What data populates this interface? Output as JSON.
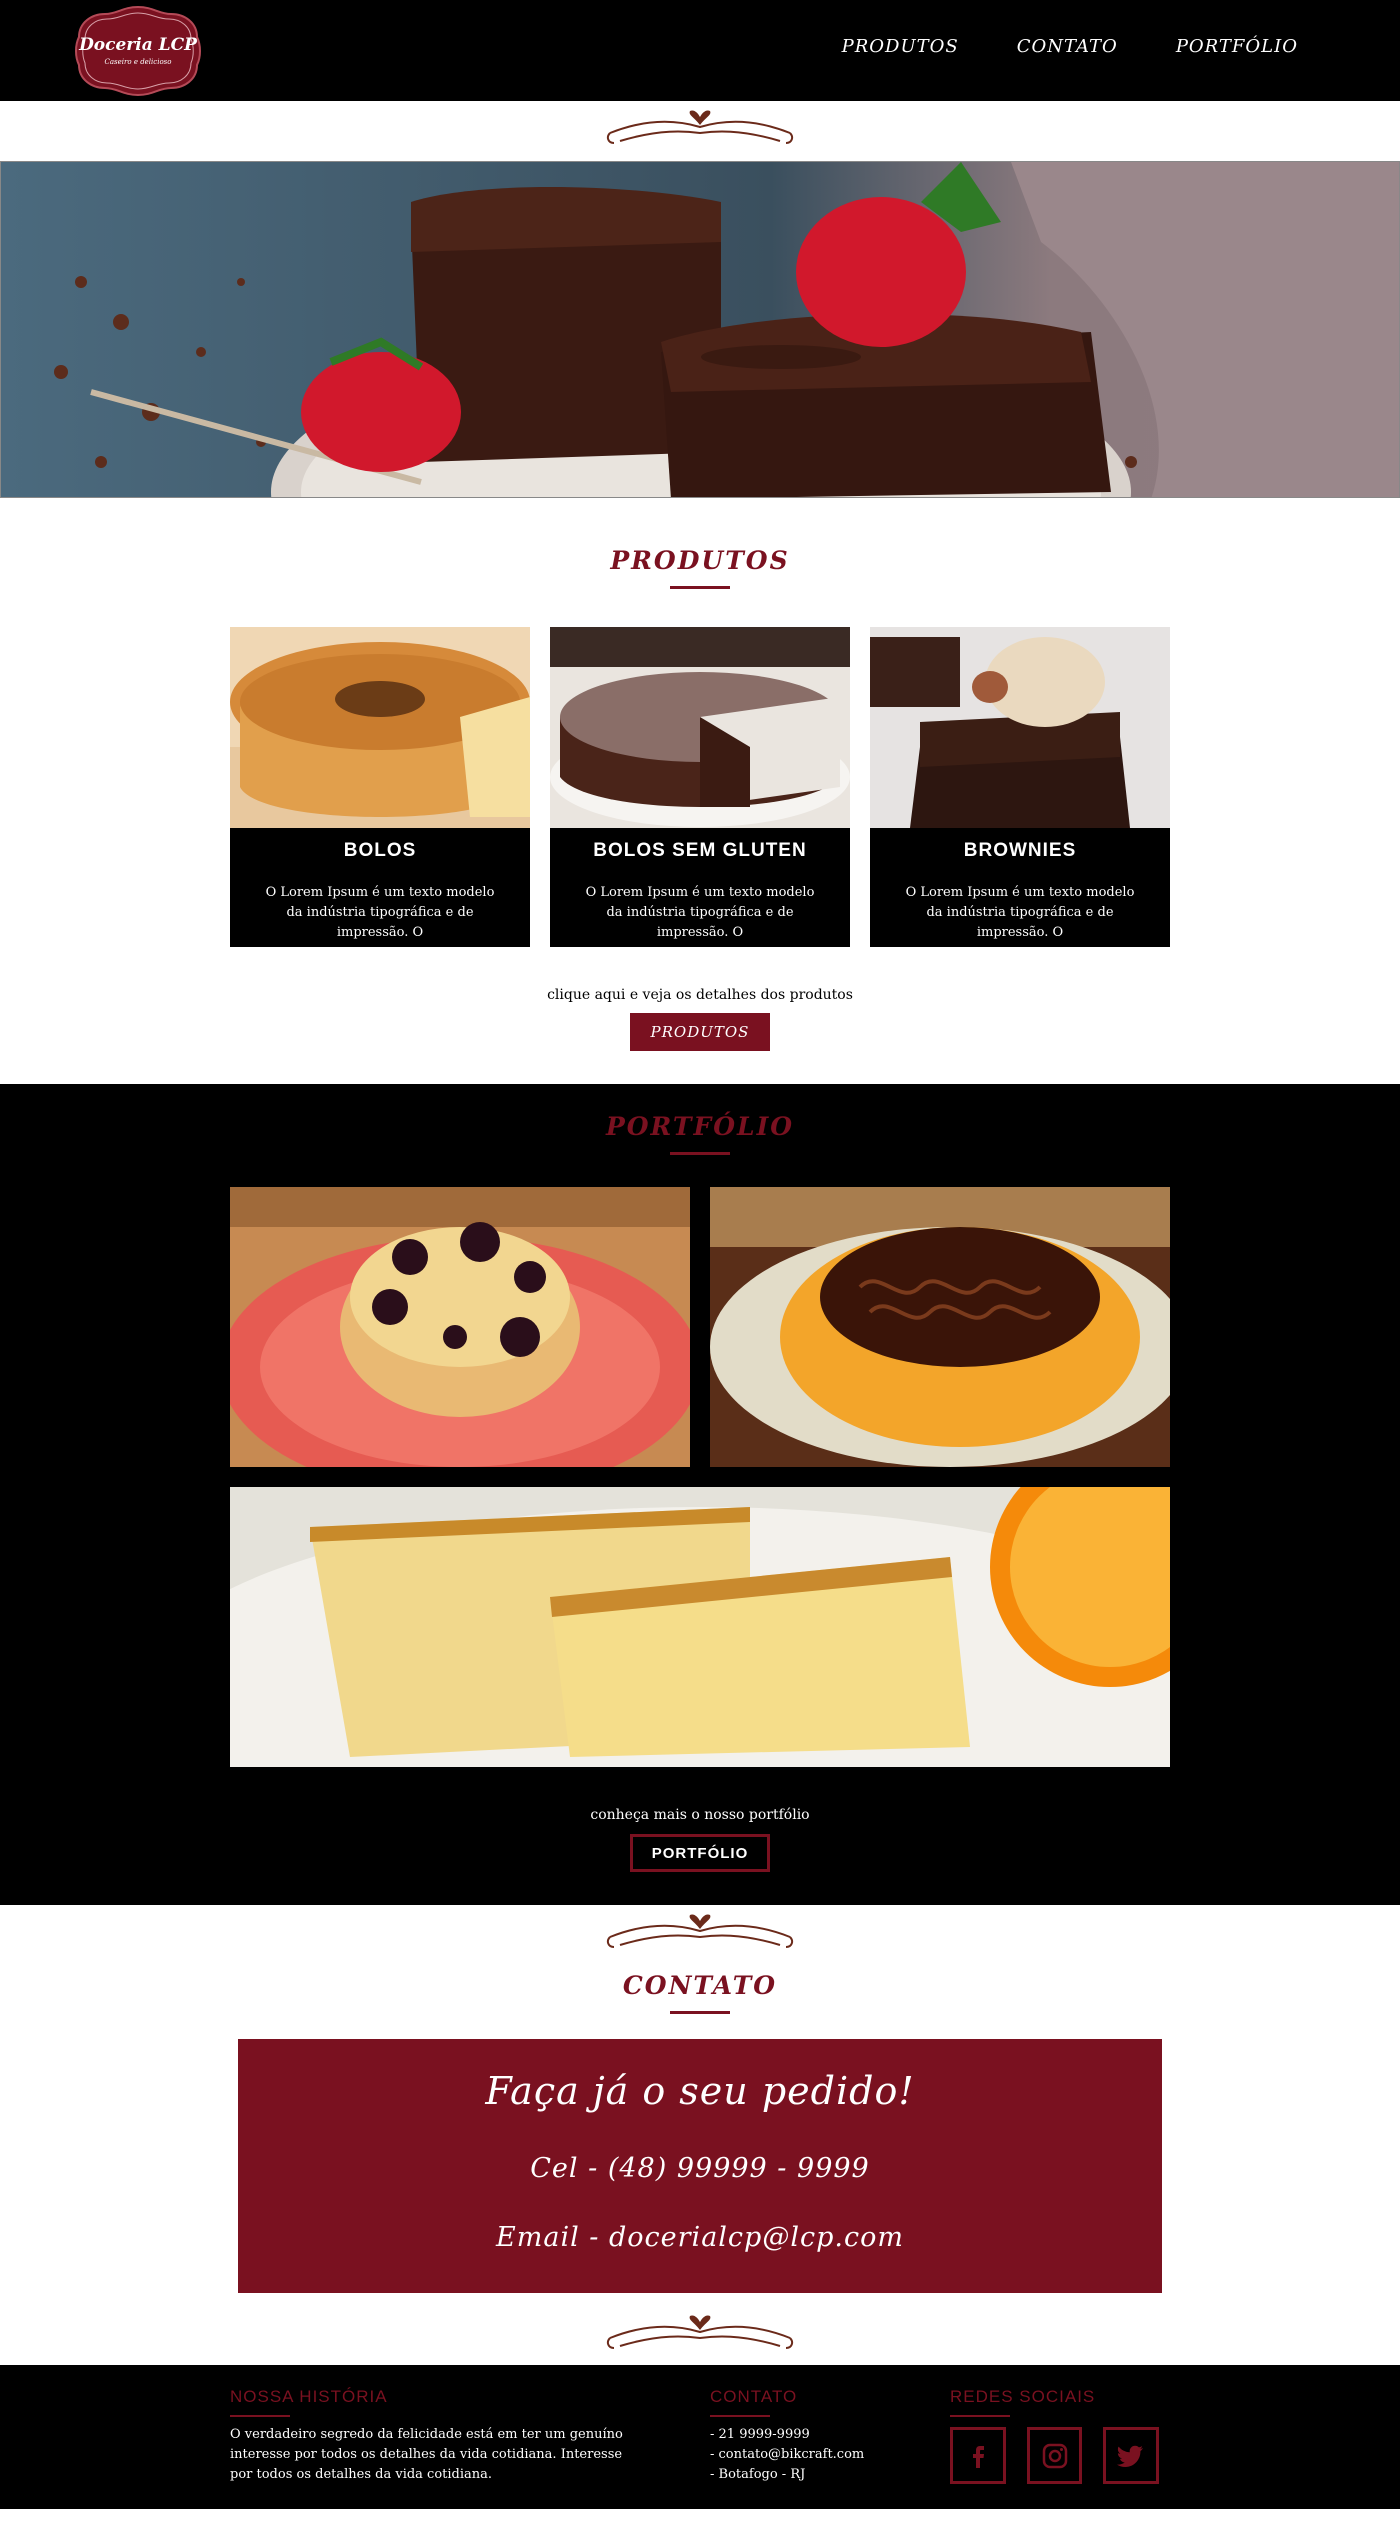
{
  "header": {
    "logo_name": "Doceria LCP",
    "logo_tagline": "Caseiro e delicioso",
    "nav": [
      {
        "label": "PRODUTOS"
      },
      {
        "label": "CONTATO"
      },
      {
        "label": "PORTFÓLIO"
      }
    ]
  },
  "produtos": {
    "title": "PRODUTOS",
    "cards": [
      {
        "title": "BOLOS",
        "text": "O Lorem Ipsum é um texto modelo da indústria tipográfica e de impressão. O"
      },
      {
        "title": "BOLOS SEM GLUTEN",
        "text": "O Lorem Ipsum é um texto modelo da indústria tipográfica e de impressão. O"
      },
      {
        "title": "BROWNIES",
        "text": "O Lorem Ipsum é um texto modelo da indústria tipográfica e de impressão. O"
      }
    ],
    "cta_text": "clique aqui e veja os detalhes dos produtos",
    "cta_button": "PRODUTOS"
  },
  "portfolio": {
    "title": "PORTFÓLIO",
    "cta_text": "conheça mais o nosso portfólio",
    "cta_button": "PORTFÓLIO"
  },
  "contato": {
    "title": "CONTATO",
    "headline": "Faça já o seu pedido!",
    "phone": "Cel - (48) 99999 - 9999",
    "email": "Email - docerialcp@lcp.com"
  },
  "footer": {
    "historia": {
      "heading": "NOSSA HISTÓRIA",
      "text": "O verdadeiro segredo da felicidade está em ter um genuíno interesse por todos os detalhes da vida cotidiana. Interesse por todos os detalhes da vida cotidiana."
    },
    "contato": {
      "heading": "CONTATO",
      "lines": [
        "- 21 9999-9999",
        "- contato@bikcraft.com",
        "- Botafogo - RJ"
      ]
    },
    "redes": {
      "heading": "REDES SOCIAIS",
      "icons": [
        "facebook-icon",
        "instagram-icon",
        "twitter-icon"
      ]
    }
  },
  "colors": {
    "brand_red": "#7a1120",
    "background_dark": "#000000"
  }
}
